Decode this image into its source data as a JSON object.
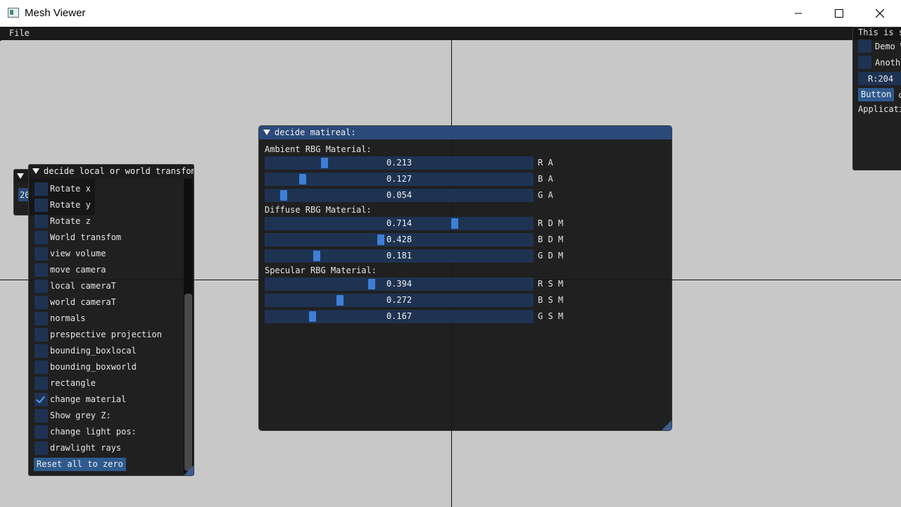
{
  "window": {
    "title": "Mesh Viewer",
    "controls": [
      "minimize-icon",
      "maximize-icon",
      "close-icon"
    ]
  },
  "menubar": {
    "file": "File"
  },
  "demo_window": {
    "title": "This is s",
    "checkbox1": "Demo W",
    "checkbox2": "Anothe",
    "color_field": "R:204",
    "button": "Button",
    "button_trail": "c",
    "footer": "Applicati"
  },
  "small_window": {
    "value": "20"
  },
  "transform_window": {
    "title": "decide local or world transfom:",
    "options": [
      {
        "label": "Rotate x",
        "checked": false
      },
      {
        "label": "Rotate y",
        "checked": false
      },
      {
        "label": "Rotate z",
        "checked": false
      },
      {
        "label": "World transfom",
        "checked": false
      },
      {
        "label": "view volume",
        "checked": false
      },
      {
        "label": "move camera",
        "checked": false
      },
      {
        "label": "local cameraT",
        "checked": false
      },
      {
        "label": "world cameraT",
        "checked": false
      },
      {
        "label": "normals",
        "checked": false
      },
      {
        "label": "prespective projection",
        "checked": false
      },
      {
        "label": "bounding_boxlocal",
        "checked": false
      },
      {
        "label": "bounding_boxworld",
        "checked": false
      },
      {
        "label": "rectangle",
        "checked": false
      },
      {
        "label": "change material",
        "checked": true
      },
      {
        "label": "Show grey Z:",
        "checked": false
      },
      {
        "label": "change light pos:",
        "checked": false
      },
      {
        "label": "drawlight rays",
        "checked": false
      }
    ],
    "reset_button": "Reset all to zero"
  },
  "material_window": {
    "title": "decide matireal:",
    "sections": [
      {
        "heading": "Ambient RBG Material:",
        "sliders": [
          {
            "value": "0.213",
            "fraction": 0.213,
            "label": "R A"
          },
          {
            "value": "0.127",
            "fraction": 0.127,
            "label": "B A"
          },
          {
            "value": "0.054",
            "fraction": 0.054,
            "label": "G A"
          }
        ]
      },
      {
        "heading": "Diffuse RBG Material:",
        "sliders": [
          {
            "value": "0.714",
            "fraction": 0.714,
            "label": "R D M"
          },
          {
            "value": "0.428",
            "fraction": 0.428,
            "label": "B D M"
          },
          {
            "value": "0.181",
            "fraction": 0.181,
            "label": "G D M"
          }
        ]
      },
      {
        "heading": "Specular RBG Material:",
        "sliders": [
          {
            "value": "0.394",
            "fraction": 0.394,
            "label": "R S M"
          },
          {
            "value": "0.272",
            "fraction": 0.272,
            "label": "B S M"
          },
          {
            "value": "0.167",
            "fraction": 0.167,
            "label": "G S M"
          }
        ]
      }
    ]
  },
  "colors": {
    "header_active": "#2b4a7a",
    "frame_bg": "#1e3352",
    "slider_grab": "#3d7fd6",
    "viewport_bg": "#c8c8c8"
  }
}
